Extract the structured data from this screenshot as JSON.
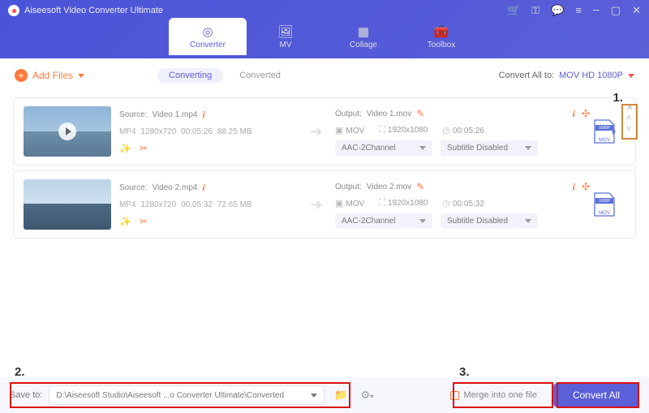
{
  "app_title": "Aiseesoft Video Converter Ultimate",
  "tabs": {
    "converter": "Converter",
    "mv": "MV",
    "collage": "Collage",
    "toolbox": "Toolbox"
  },
  "toolbar": {
    "add_files": "Add Files"
  },
  "subtabs": {
    "converting": "Converting",
    "converted": "Converted"
  },
  "convert_all_to": {
    "label": "Convert All to:",
    "value": "MOV HD 1080P"
  },
  "files": [
    {
      "source_label": "Source:",
      "source_name": "Video 1.mp4",
      "format": "MP4",
      "resolution": "1280x720",
      "duration": "00:05:26",
      "size": "88.25 MB",
      "output_label": "Output:",
      "output_name": "Video 1.mov",
      "out_format": "MOV",
      "out_resolution": "1920x1080",
      "out_duration": "00:05:26",
      "audio_sel": "AAC-2Channel",
      "sub_sel": "Subtitle Disabled",
      "badge": "1080P",
      "badge_fmt": "MOV"
    },
    {
      "source_label": "Source:",
      "source_name": "Video 2.mp4",
      "format": "MP4",
      "resolution": "1280x720",
      "duration": "00:05:32",
      "size": "72.65 MB",
      "output_label": "Output:",
      "output_name": "Video 2.mov",
      "out_format": "MOV",
      "out_resolution": "1920x1080",
      "out_duration": "00:05:32",
      "audio_sel": "AAC-2Channel",
      "sub_sel": "Subtitle Disabled",
      "badge": "1080P",
      "badge_fmt": "MOV"
    }
  ],
  "bottom": {
    "save_to_label": "Save to:",
    "path": "D:\\Aiseesoft Studio\\Aiseesoft ...o Converter Ultimate\\Converted",
    "merge_label": "Merge into one file",
    "convert_all": "Convert All"
  },
  "callouts": {
    "one": "1.",
    "two": "2.",
    "three": "3."
  }
}
